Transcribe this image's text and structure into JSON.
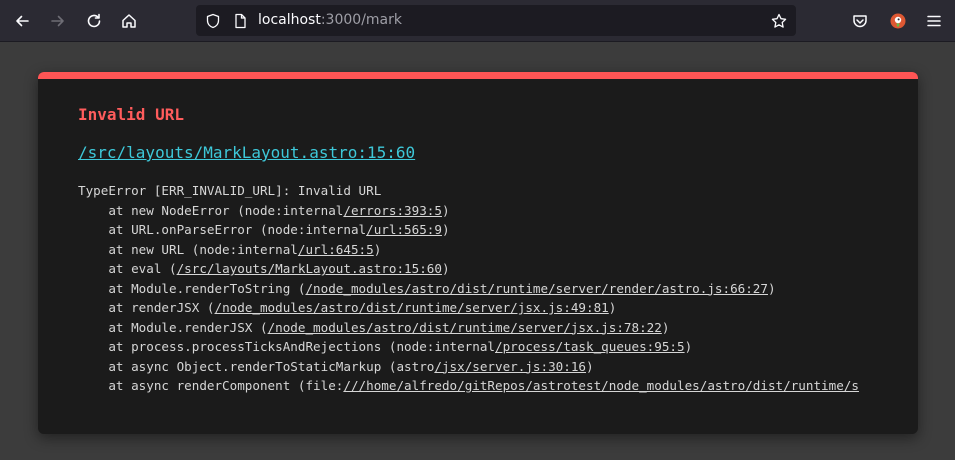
{
  "browser": {
    "url_host": "localhost",
    "url_rest": ":3000/mark"
  },
  "error": {
    "title": "Invalid URL",
    "file": "/src/layouts/MarkLayout.astro:15:60",
    "stack": [
      {
        "pre": "TypeError [ERR_INVALID_URL]: Invalid URL",
        "link": "",
        "post": ""
      },
      {
        "pre": "    at new NodeError (node:internal",
        "link": "/errors:393:5",
        "post": ")"
      },
      {
        "pre": "    at URL.onParseError (node:internal",
        "link": "/url:565:9",
        "post": ")"
      },
      {
        "pre": "    at new URL (node:internal",
        "link": "/url:645:5",
        "post": ")"
      },
      {
        "pre": "    at eval (",
        "link": "/src/layouts/MarkLayout.astro:15:60",
        "post": ")"
      },
      {
        "pre": "    at Module.renderToString (",
        "link": "/node_modules/astro/dist/runtime/server/render/astro.js:66:27",
        "post": ")"
      },
      {
        "pre": "    at renderJSX (",
        "link": "/node_modules/astro/dist/runtime/server/jsx.js:49:81",
        "post": ")"
      },
      {
        "pre": "    at Module.renderJSX (",
        "link": "/node_modules/astro/dist/runtime/server/jsx.js:78:22",
        "post": ")"
      },
      {
        "pre": "    at process.processTicksAndRejections (node:internal",
        "link": "/process/task_queues:95:5",
        "post": ")"
      },
      {
        "pre": "    at async Object.renderToStaticMarkup (astro",
        "link": "/jsx/server.js:30:16",
        "post": ")"
      },
      {
        "pre": "    at async renderComponent (file:",
        "link": "///home/alfredo/gitRepos/astrotest/node_modules/astro/dist/runtime/s",
        "post": ""
      }
    ]
  },
  "colors": {
    "accent_red": "#ff5555",
    "link_cyan": "#3ec8d9",
    "card_bg": "#1b1b1b"
  }
}
